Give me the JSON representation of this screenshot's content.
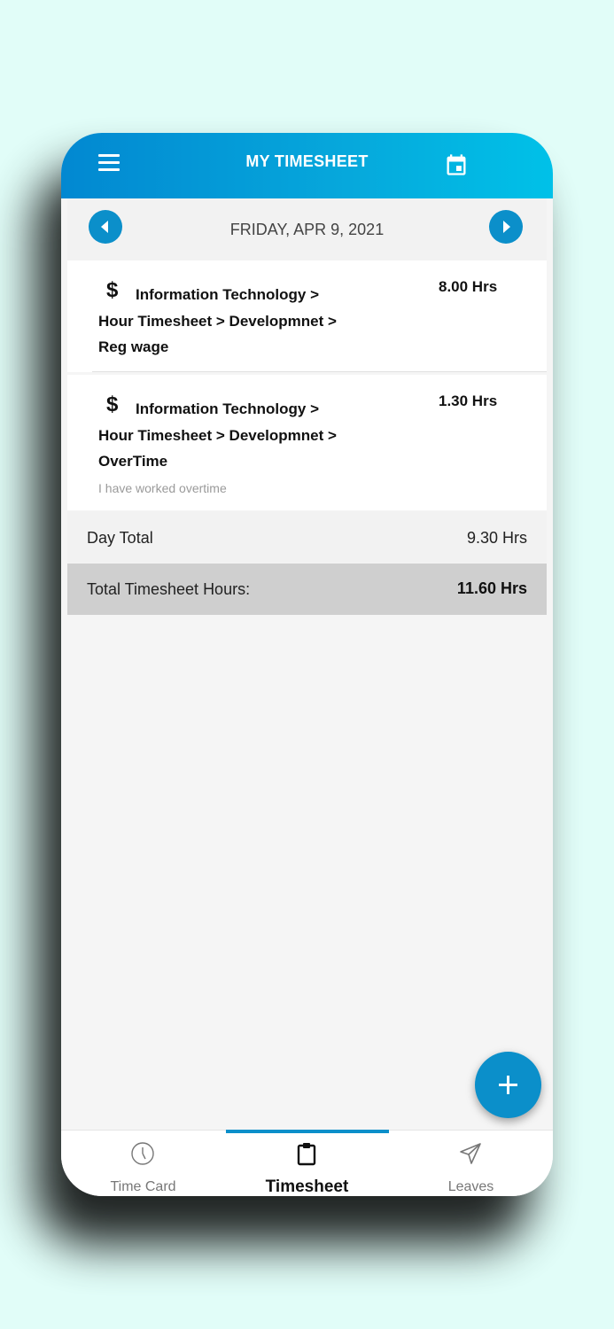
{
  "header": {
    "title": "MY TIMESHEET"
  },
  "date_nav": {
    "date": "FRIDAY, APR 9, 2021"
  },
  "entries": [
    {
      "currency_symbol": "$",
      "line1": "Information Technology >",
      "line2": "Hour Timesheet > Developmnet >",
      "line3": "Reg wage",
      "hours": "8.00 Hrs",
      "note": ""
    },
    {
      "currency_symbol": "$",
      "line1": "Information Technology >",
      "line2": "Hour Timesheet > Developmnet >",
      "line3": "OverTime",
      "hours": "1.30 Hrs",
      "note": "I have worked overtime"
    }
  ],
  "day_total": {
    "label": "Day Total",
    "value": "9.30 Hrs"
  },
  "timesheet_total": {
    "label": "Total Timesheet Hours:",
    "value": "11.60 Hrs"
  },
  "fab": {
    "icon": "plus-icon"
  },
  "tabs": [
    {
      "label": "Time Card",
      "icon": "clock-icon",
      "active": false
    },
    {
      "label": "Timesheet",
      "icon": "clipboard-icon",
      "active": true
    },
    {
      "label": "Leaves",
      "icon": "send-icon",
      "active": false
    }
  ],
  "colors": {
    "accent": "#0b8fca",
    "header_gradient_start": "#0288d1",
    "header_gradient_end": "#00c1e8",
    "background": "#e1fdf8"
  }
}
